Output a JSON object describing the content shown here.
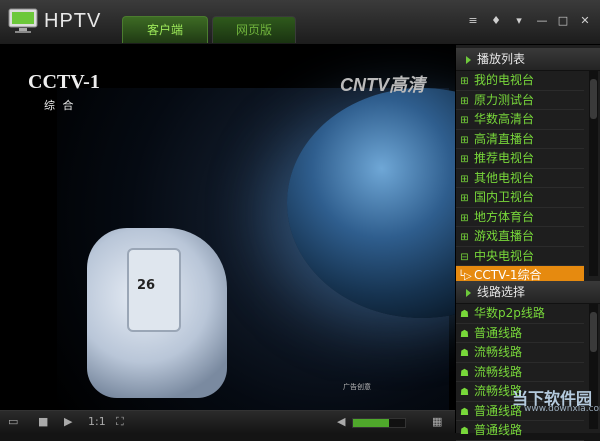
{
  "app": {
    "title": "HPTV"
  },
  "tabs": [
    {
      "label": "客户端",
      "active": true
    },
    {
      "label": "网页版",
      "active": false
    }
  ],
  "window_buttons": [
    "≡",
    "♦",
    "▾",
    "—",
    "□",
    "✕"
  ],
  "video": {
    "cctv_logo": "CCTV-1",
    "cctv_sub": "综 合",
    "cntv_logo": "CNTV高清",
    "ad_text": "广告创意",
    "phone_reading": "26"
  },
  "controls": {
    "ratio": "1:1",
    "volume_percent": 70
  },
  "playlist": {
    "header": "播放列表",
    "items": [
      {
        "label": "我的电视台",
        "prefix": "⊞"
      },
      {
        "label": "原力测试台",
        "prefix": "⊞"
      },
      {
        "label": "华数高清台",
        "prefix": "⊞"
      },
      {
        "label": "高清直播台",
        "prefix": "⊞"
      },
      {
        "label": "推荐电视台",
        "prefix": "⊞"
      },
      {
        "label": "其他电视台",
        "prefix": "⊞"
      },
      {
        "label": "国内卫视台",
        "prefix": "⊞"
      },
      {
        "label": "地方体育台",
        "prefix": "⊞"
      },
      {
        "label": "游戏直播台",
        "prefix": "⊞"
      },
      {
        "label": "中央电视台",
        "prefix": "⊟"
      },
      {
        "label": "CCTV-1综合",
        "prefix": "└▷",
        "selected": true
      }
    ]
  },
  "routes": {
    "header": "线路选择",
    "items": [
      {
        "label": "华数p2p线路"
      },
      {
        "label": "普通线路"
      },
      {
        "label": "流畅线路"
      },
      {
        "label": "流畅线路"
      },
      {
        "label": "流畅线路"
      },
      {
        "label": "普通线路"
      },
      {
        "label": "普通线路"
      }
    ]
  },
  "watermark": {
    "text": "当下软件园",
    "sub": "www.downxia.com"
  },
  "colors": {
    "accent_green": "#78d83a",
    "selected_orange": "#e68a0f"
  }
}
